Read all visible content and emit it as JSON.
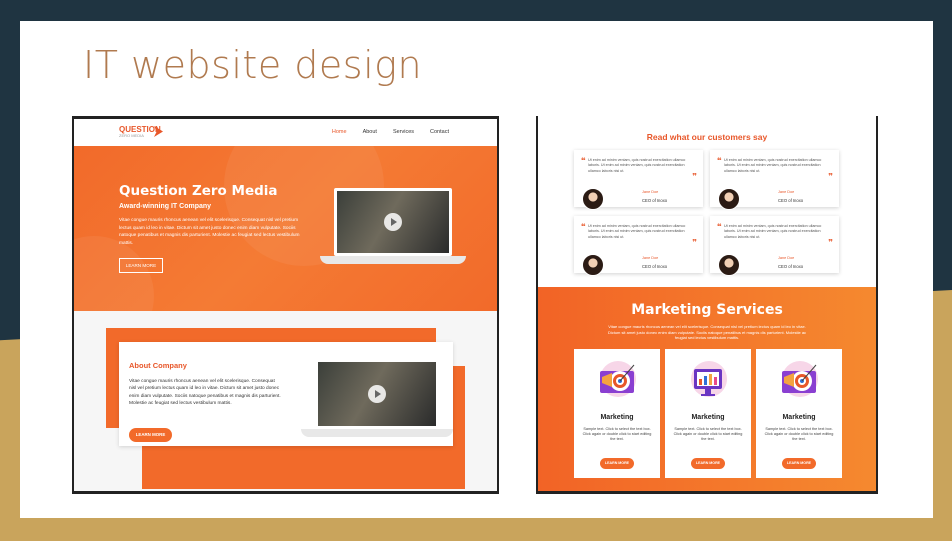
{
  "slide": {
    "title": "IT website design"
  },
  "left_mockup": {
    "logo": {
      "name": "QUESTION",
      "tagline": "ZERO MEDIA"
    },
    "nav": [
      "Home",
      "About",
      "Services",
      "Contact"
    ],
    "hero": {
      "title": "Question Zero Media",
      "subtitle": "Award-winning IT Company",
      "body": "Vitae congue mauris rhoncus aenean vel elit scelerisque. Consequat nisl vel pretium lectus quam id leo in vitae. Dictum sit amet justo donec enim diam vulputate. Sociis natoque penatibus et magnis dis parturient. Molestie ac feugiat sed lectus vestibulum mattis.",
      "button": "LEARN MORE"
    },
    "about": {
      "title": "About Company",
      "body": "Vitae congue mauris rhoncus aenean vel elit scelerisque. Consequat nisl vel pretium lectus quam id leo in vitae. Dictum sit amet justo donec enim diam vulputate. Sociis natoque penatibus et magnis dis parturient. Molestie ac feugiat sed lectus vestibulum mattis.",
      "button": "LEARN MORE"
    }
  },
  "right_mockup": {
    "reviews_title": "Read what our customers say",
    "reviews": [
      {
        "text": "Ut enim ad minim veniam, quis nostrud exercitation ullamco laboris. Ut enim ad minim veniam, quis nostrud exercitation ullamco laboris nisi ut.",
        "name": "Jane Doe",
        "role": "CEO of Inoxo"
      },
      {
        "text": "Ut enim ad minim veniam, quis nostrud exercitation ullamco laboris. Ut enim ad minim veniam, quis nostrud exercitation ullamco laboris nisi ut.",
        "name": "Jane Doe",
        "role": "CEO of Inoxo"
      },
      {
        "text": "Ut enim ad minim veniam, quis nostrud exercitation ullamco laboris. Ut enim ad minim veniam, quis nostrud exercitation ullamco laboris nisi ut.",
        "name": "Jane Doe",
        "role": "CEO of Inoxo"
      },
      {
        "text": "Ut enim ad minim veniam, quis nostrud exercitation ullamco laboris. Ut enim ad minim veniam, quis nostrud exercitation ullamco laboris nisi ut.",
        "name": "Jane Doe",
        "role": "CEO of Inoxo"
      }
    ],
    "marketing": {
      "title": "Marketing Services",
      "body": "Vitae congue mauris rhoncus aenean vel elit scelerisque. Consequat nisl vel pretium lectus quam id leo in vitae. Dictum sit amet justo donec enim diam vulputate. Sociis natoque penatibus et magnis dis parturient. Molestie ac feugiat sed lectus vestibulum mattis.",
      "cards": [
        {
          "title": "Marketing",
          "text": "Sample text. Click to select the text box. Click again or double click to start editing the text.",
          "button": "LEARN MORE"
        },
        {
          "title": "Marketing",
          "text": "Sample text. Click to select the text box. Click again or double click to start editing the text.",
          "button": "LEARN MORE"
        },
        {
          "title": "Marketing",
          "text": "Sample text. Click to select the text box. Click again or double click to start editing the text.",
          "button": "LEARN MORE"
        }
      ]
    }
  },
  "colors": {
    "accent": "#f26a2a",
    "title": "#b07a4f",
    "background": "#1f3441",
    "gold": "#c9a45c"
  }
}
